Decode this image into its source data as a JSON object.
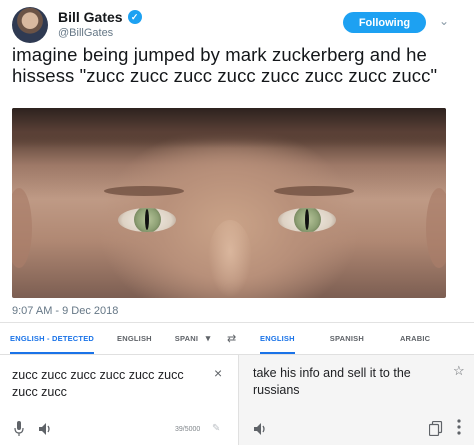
{
  "tweet": {
    "author_name": "Bill Gates",
    "verified_mark": "✓",
    "handle": "@BillGates",
    "follow_button_label": "Following",
    "caret": "⌄",
    "text": "imagine being jumped by mark zuckerberg and he hissess \"zucc zucc zucc zucc zucc zucc zucc zucc\"",
    "timestamp": "9:07 AM - 9 Dec 2018",
    "colors": {
      "accent": "#1da1f2",
      "text": "#14171a",
      "muted": "#657786"
    }
  },
  "translate": {
    "source_tabs": [
      "ENGLISH - DETECTED",
      "ENGLISH",
      "SPANI"
    ],
    "target_tabs": [
      "ENGLISH",
      "SPANISH",
      "ARABIC"
    ],
    "swap_icon": "⇄",
    "source_text": "zucc zucc zucc zucc zucc zucc zucc zucc",
    "clear_icon": "×",
    "target_text": "take his info and sell it to the russians",
    "star_icon": "☆",
    "char_counter": "39/5000",
    "pencil_icon": "✎",
    "colors": {
      "active_tab": "#1a73e8",
      "icon": "#5f6368",
      "target_bg": "#f5f5f5"
    }
  }
}
